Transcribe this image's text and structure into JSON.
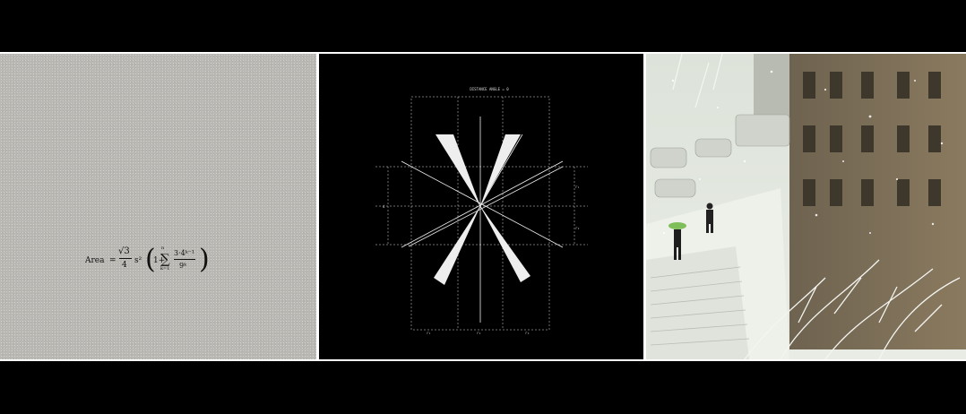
{
  "panels": {
    "formula": {
      "lhs": "Area",
      "eq": "=",
      "sqrt": "√3",
      "den4": "4",
      "s2": "s²",
      "one_plus": "1+",
      "sum": "∑",
      "sum_top": "n",
      "sum_bottom": "k=1",
      "num": "3·4ᵏ⁻¹",
      "den": "9ᵏ"
    },
    "cad": {
      "title": "DISTANCE ANGLE = 0"
    },
    "photo": {}
  }
}
